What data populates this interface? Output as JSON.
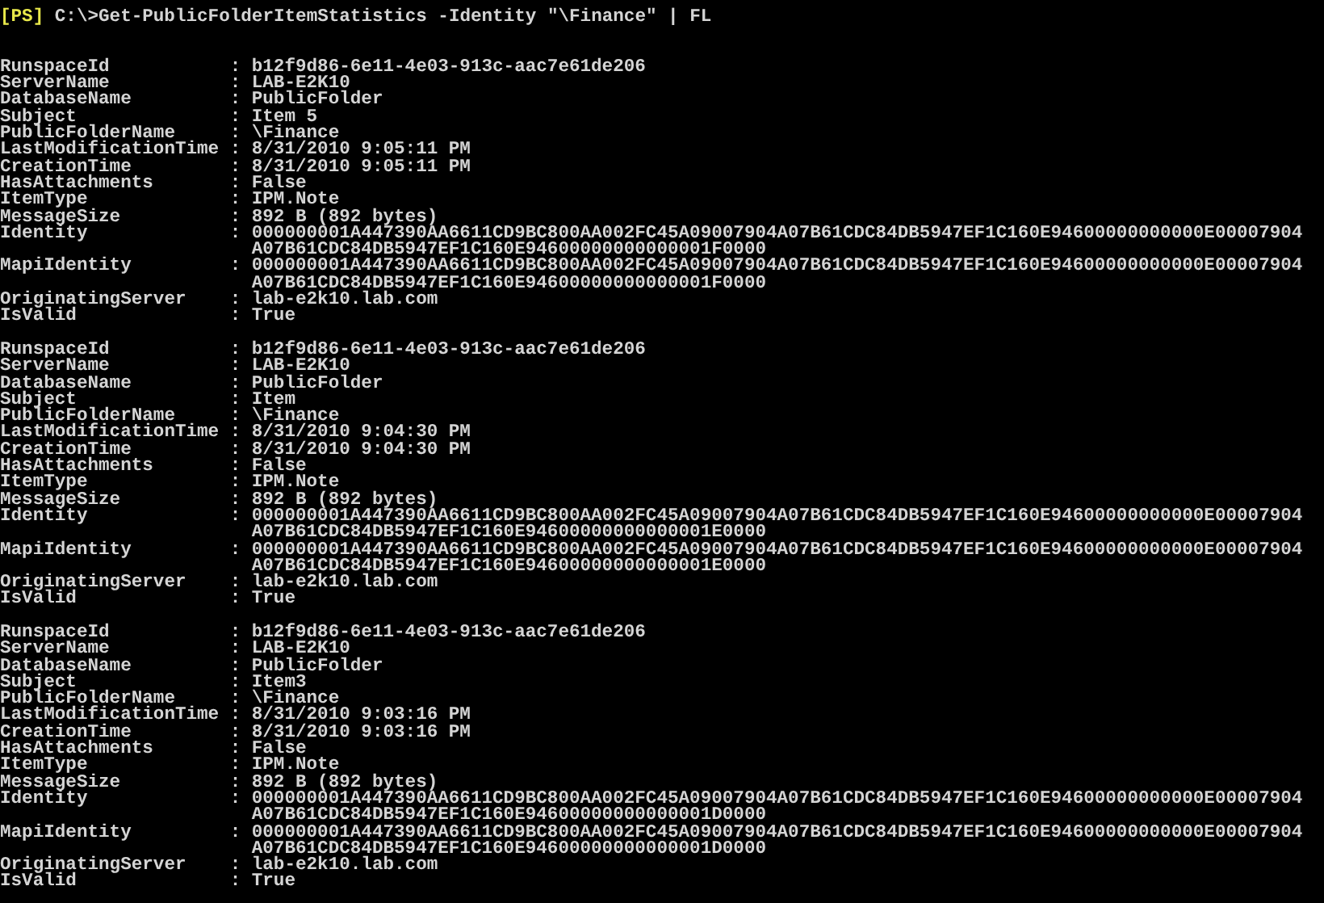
{
  "prompt": {
    "tag": "[PS]",
    "command": "C:\\>Get-PublicFolderItemStatistics -Identity \"\\Finance\" | FL"
  },
  "records": [
    {
      "properties": [
        {
          "name": "RunspaceId",
          "sep": ":",
          "lines": [
            "b12f9d86-6e11-4e03-913c-aac7e61de206"
          ]
        },
        {
          "name": "ServerName",
          "sep": ":",
          "lines": [
            "LAB-E2K10"
          ]
        },
        {
          "name": "DatabaseName",
          "sep": ":",
          "lines": [
            "PublicFolder"
          ]
        },
        {
          "name": "Subject",
          "sep": ":",
          "lines": [
            "Item 5"
          ]
        },
        {
          "name": "PublicFolderName",
          "sep": ":",
          "lines": [
            "\\Finance"
          ]
        },
        {
          "name": "LastModificationTime",
          "sep": ":",
          "lines": [
            "8/31/2010 9:05:11 PM"
          ]
        },
        {
          "name": "CreationTime",
          "sep": ":",
          "lines": [
            "8/31/2010 9:05:11 PM"
          ]
        },
        {
          "name": "HasAttachments",
          "sep": ":",
          "lines": [
            "False"
          ]
        },
        {
          "name": "ItemType",
          "sep": ":",
          "lines": [
            "IPM.Note"
          ]
        },
        {
          "name": "MessageSize",
          "sep": ":",
          "lines": [
            "892 B (892 bytes)"
          ]
        },
        {
          "name": "Identity",
          "sep": ":",
          "lines": [
            "000000001A447390AA6611CD9BC800AA002FC45A09007904A07B61CDC84DB5947EF1C160E94600000000000E00007904",
            "A07B61CDC84DB5947EF1C160E94600000000000001F0000"
          ]
        },
        {
          "name": "MapiIdentity",
          "sep": ":",
          "lines": [
            "000000001A447390AA6611CD9BC800AA002FC45A09007904A07B61CDC84DB5947EF1C160E94600000000000E00007904",
            "A07B61CDC84DB5947EF1C160E94600000000000001F0000"
          ]
        },
        {
          "name": "OriginatingServer",
          "sep": ":",
          "lines": [
            "lab-e2k10.lab.com"
          ]
        },
        {
          "name": "IsValid",
          "sep": ":",
          "lines": [
            "True"
          ]
        }
      ]
    },
    {
      "properties": [
        {
          "name": "RunspaceId",
          "sep": ":",
          "lines": [
            "b12f9d86-6e11-4e03-913c-aac7e61de206"
          ]
        },
        {
          "name": "ServerName",
          "sep": ":",
          "lines": [
            "LAB-E2K10"
          ]
        },
        {
          "name": "DatabaseName",
          "sep": ":",
          "lines": [
            "PublicFolder"
          ]
        },
        {
          "name": "Subject",
          "sep": ":",
          "lines": [
            "Item"
          ]
        },
        {
          "name": "PublicFolderName",
          "sep": ":",
          "lines": [
            "\\Finance"
          ]
        },
        {
          "name": "LastModificationTime",
          "sep": ":",
          "lines": [
            "8/31/2010 9:04:30 PM"
          ]
        },
        {
          "name": "CreationTime",
          "sep": ":",
          "lines": [
            "8/31/2010 9:04:30 PM"
          ]
        },
        {
          "name": "HasAttachments",
          "sep": ":",
          "lines": [
            "False"
          ]
        },
        {
          "name": "ItemType",
          "sep": ":",
          "lines": [
            "IPM.Note"
          ]
        },
        {
          "name": "MessageSize",
          "sep": ":",
          "lines": [
            "892 B (892 bytes)"
          ]
        },
        {
          "name": "Identity",
          "sep": ":",
          "lines": [
            "000000001A447390AA6611CD9BC800AA002FC45A09007904A07B61CDC84DB5947EF1C160E94600000000000E00007904",
            "A07B61CDC84DB5947EF1C160E94600000000000001E0000"
          ]
        },
        {
          "name": "MapiIdentity",
          "sep": ":",
          "lines": [
            "000000001A447390AA6611CD9BC800AA002FC45A09007904A07B61CDC84DB5947EF1C160E94600000000000E00007904",
            "A07B61CDC84DB5947EF1C160E94600000000000001E0000"
          ]
        },
        {
          "name": "OriginatingServer",
          "sep": ":",
          "lines": [
            "lab-e2k10.lab.com"
          ]
        },
        {
          "name": "IsValid",
          "sep": ":",
          "lines": [
            "True"
          ]
        }
      ]
    },
    {
      "properties": [
        {
          "name": "RunspaceId",
          "sep": ":",
          "lines": [
            "b12f9d86-6e11-4e03-913c-aac7e61de206"
          ]
        },
        {
          "name": "ServerName",
          "sep": ":",
          "lines": [
            "LAB-E2K10"
          ]
        },
        {
          "name": "DatabaseName",
          "sep": ":",
          "lines": [
            "PublicFolder"
          ]
        },
        {
          "name": "Subject",
          "sep": ":",
          "lines": [
            "Item3"
          ]
        },
        {
          "name": "PublicFolderName",
          "sep": ":",
          "lines": [
            "\\Finance"
          ]
        },
        {
          "name": "LastModificationTime",
          "sep": ":",
          "lines": [
            "8/31/2010 9:03:16 PM"
          ]
        },
        {
          "name": "CreationTime",
          "sep": ":",
          "lines": [
            "8/31/2010 9:03:16 PM"
          ]
        },
        {
          "name": "HasAttachments",
          "sep": ":",
          "lines": [
            "False"
          ]
        },
        {
          "name": "ItemType",
          "sep": ":",
          "lines": [
            "IPM.Note"
          ]
        },
        {
          "name": "MessageSize",
          "sep": ":",
          "lines": [
            "892 B (892 bytes)"
          ]
        },
        {
          "name": "Identity",
          "sep": ":",
          "lines": [
            "000000001A447390AA6611CD9BC800AA002FC45A09007904A07B61CDC84DB5947EF1C160E94600000000000E00007904",
            "A07B61CDC84DB5947EF1C160E94600000000000001D0000"
          ]
        },
        {
          "name": "MapiIdentity",
          "sep": ":",
          "lines": [
            "000000001A447390AA6611CD9BC800AA002FC45A09007904A07B61CDC84DB5947EF1C160E94600000000000E00007904",
            "A07B61CDC84DB5947EF1C160E94600000000000001D0000"
          ]
        },
        {
          "name": "OriginatingServer",
          "sep": ":",
          "lines": [
            "lab-e2k10.lab.com"
          ]
        },
        {
          "name": "IsValid",
          "sep": ":",
          "lines": [
            "True"
          ]
        }
      ]
    }
  ]
}
